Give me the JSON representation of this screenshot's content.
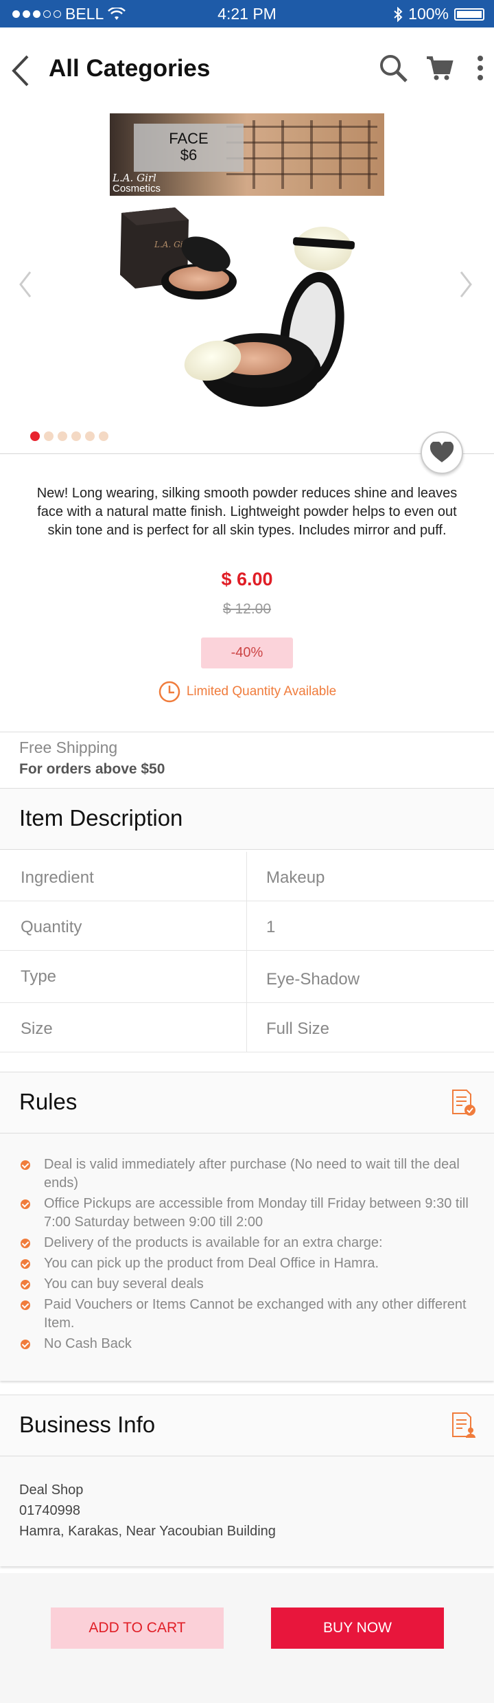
{
  "status": {
    "carrier": "BELL",
    "time": "4:21 PM",
    "battery": "100%"
  },
  "nav": {
    "title": "All Categories"
  },
  "banner": {
    "tag_line1": "FACE",
    "tag_line2": "$6",
    "brand_line1": "L.A. Girl",
    "brand_line2": "Cosmetics"
  },
  "product_visual_text": "L.A. Girl",
  "gallery": {
    "slide_count": 6,
    "active_slide": 1
  },
  "product": {
    "description": "New! Long wearing, silking smooth powder reduces shine and leaves face with a natural matte finish. Lightweight powder helps to even out skin tone and is perfect for all skin types. Includes mirror and puff.",
    "price": "$ 6.00",
    "old_price": "$ 12.00",
    "discount": "-40%",
    "limited": "Limited Quantity Available"
  },
  "shipping": {
    "title": "Free Shipping",
    "subtitle": "For orders above $50"
  },
  "item_description": {
    "heading": "Item Description",
    "rows": [
      {
        "key": "Ingredient",
        "value": "Makeup"
      },
      {
        "key": "Quantity",
        "value": "1"
      },
      {
        "key": "Type",
        "value": "Eye-Shadow"
      },
      {
        "key": "Size",
        "value": "Full Size"
      }
    ]
  },
  "rules": {
    "heading": "Rules",
    "items": [
      "Deal is valid immediately after purchase (No need to wait till the deal ends)",
      "Office Pickups are accessible from Monday till Friday between 9:30 till 7:00 Saturday between 9:00 till 2:00",
      "Delivery of the products is available for an extra charge:",
      "You can pick up the product from Deal Office in Hamra.",
      "You can buy several deals",
      "Paid Vouchers or Items Cannot be exchanged with any other different Item.",
      "No Cash Back"
    ]
  },
  "business": {
    "heading": "Business Info",
    "name": "Deal Shop",
    "phone": "01740998",
    "address": "Hamra, Karakas, Near Yacoubian Building"
  },
  "actions": {
    "add_to_cart": "ADD TO CART",
    "buy_now": "BUY NOW"
  },
  "colors": {
    "status_bar": "#1e5ba8",
    "accent_red": "#e01e26",
    "accent_orange": "#f07c3c"
  }
}
